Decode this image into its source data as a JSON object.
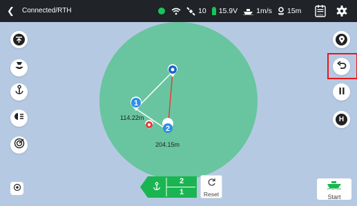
{
  "header": {
    "status_title": "Connected/RTH",
    "satellites": "10",
    "voltage": "15.9V",
    "speed": "1m/s",
    "depth": "15m",
    "connection_color": "#19c35b"
  },
  "left_toolbar": {
    "items": [
      {
        "icon": "up-arrow-icon"
      },
      {
        "icon": "sonar-icon"
      },
      {
        "icon": "anchor-icon"
      },
      {
        "icon": "light-icon"
      },
      {
        "icon": "radar-icon"
      }
    ]
  },
  "right_toolbar": {
    "items": [
      {
        "icon": "location-pin-icon"
      },
      {
        "icon": "return-icon"
      },
      {
        "icon": "pause-icon"
      },
      {
        "icon": "home-icon",
        "label": "H"
      }
    ]
  },
  "map": {
    "waypoints": [
      {
        "label": "1",
        "distance": "114.22m"
      },
      {
        "label": "2",
        "distance": "204.15m"
      }
    ]
  },
  "route_panel": {
    "row1": "2",
    "row2": "1",
    "color": "#1ab552"
  },
  "reset_label": "Reset",
  "start_label": "Start"
}
